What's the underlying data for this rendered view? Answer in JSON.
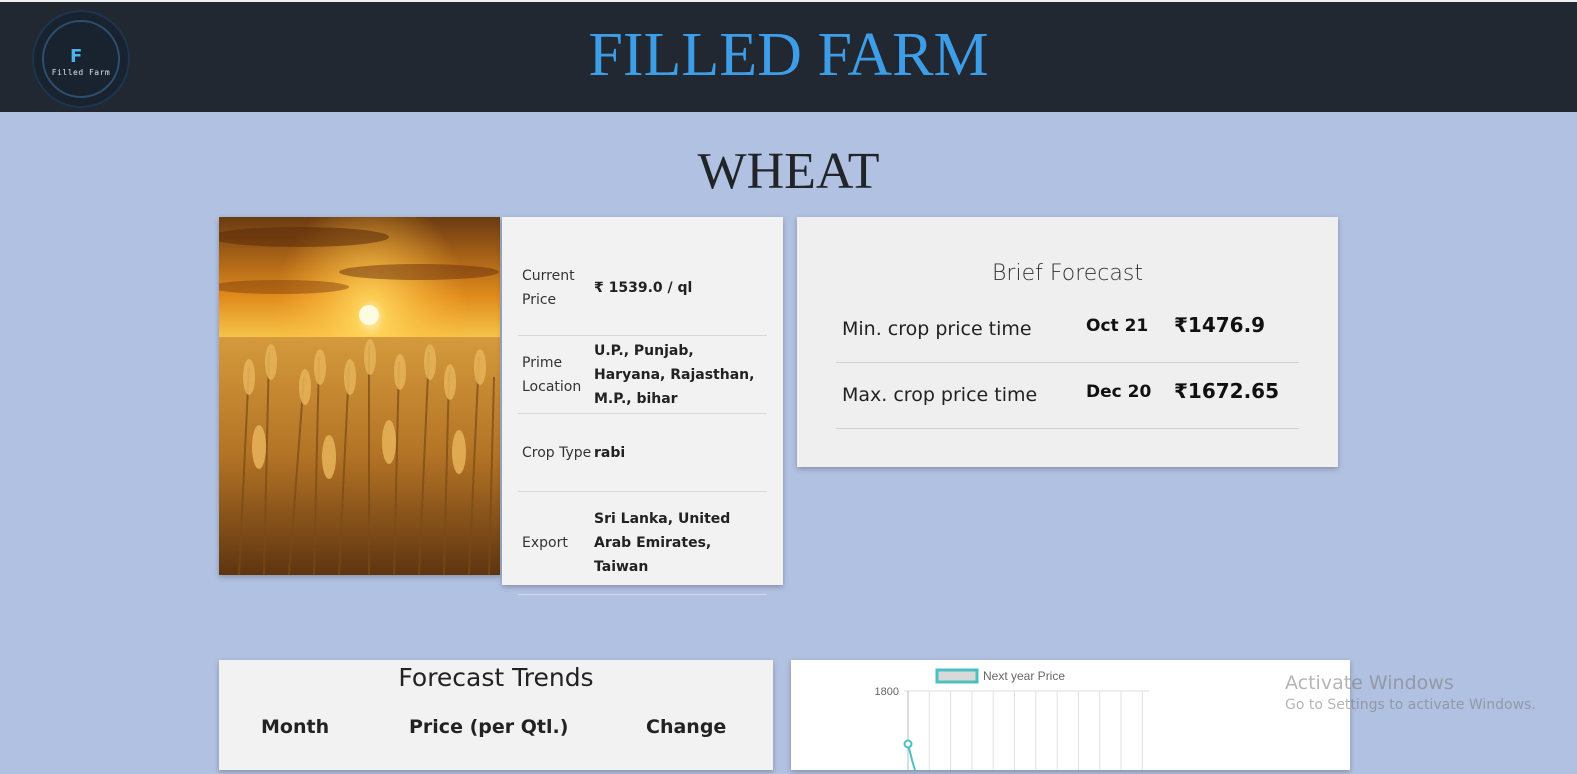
{
  "header": {
    "brand": "FILLED FARM",
    "logo_text": "Filled Farm",
    "logo_mark": "F"
  },
  "page": {
    "title": "WHEAT"
  },
  "crop_image": {
    "alt": "wheat-field-sunset-image"
  },
  "info": {
    "rows": [
      {
        "label": "Current Price",
        "value": "₹ 1539.0 / ql"
      },
      {
        "label": "Prime Location",
        "value": "U.P., Punjab, Haryana, Rajasthan, M.P., bihar"
      },
      {
        "label": "Crop Type",
        "value": "rabi"
      },
      {
        "label": "Export",
        "value": "Sri Lanka, United Arab Emirates, Taiwan"
      }
    ]
  },
  "brief_forecast": {
    "title": "Brief Forecast",
    "rows": [
      {
        "label": "Min. crop price time",
        "date": "Oct 21",
        "price": "₹1476.9"
      },
      {
        "label": "Max. crop price time",
        "date": "Dec 20",
        "price": "₹1672.65"
      }
    ]
  },
  "forecast_trends": {
    "title": "Forecast Trends",
    "columns": [
      "Month",
      "Price (per Qtl.)",
      "Change"
    ]
  },
  "chart_data": {
    "type": "line",
    "series": [
      {
        "name": "Next year Price",
        "values": []
      }
    ],
    "yticks": [
      "1800"
    ],
    "color": "#4bc0c0"
  },
  "system": {
    "watermark_title": "Activate Windows",
    "watermark_sub": "Go to Settings to activate Windows."
  },
  "colors": {
    "background": "#b1c1e1",
    "navbar": "#212832",
    "brand": "#3d9de6"
  }
}
